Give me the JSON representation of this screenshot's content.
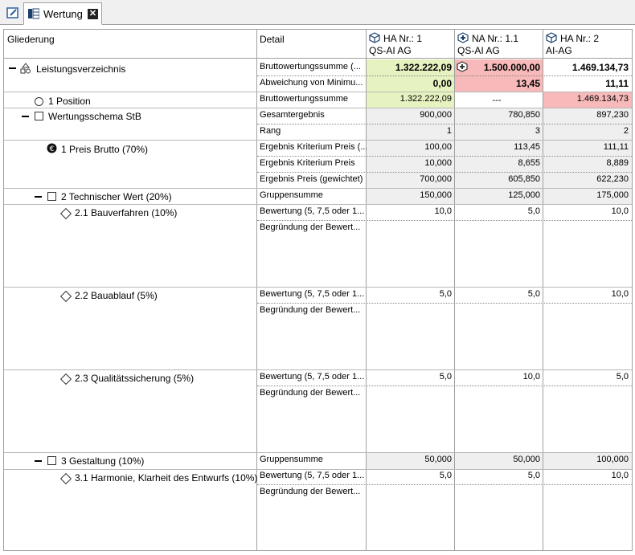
{
  "tab": {
    "label": "Wertung",
    "close": "✕"
  },
  "columns": {
    "gliederung": "Gliederung",
    "detail": "Detail",
    "bidders": [
      {
        "line1": "HA Nr.: 1",
        "line2": "QS-AI AG"
      },
      {
        "line1": "NA Nr.: 1.1",
        "line2": "QS-AI AG"
      },
      {
        "line1": "HA Nr.: 2",
        "line2": "AI-AG"
      }
    ]
  },
  "tree": {
    "lv": "Leistungsverzeichnis",
    "position": "1 Position",
    "schema": "Wertungsschema StB",
    "preis": "1 Preis Brutto (70%)",
    "techn": "2 Technischer Wert (20%)",
    "bauverf": "2.1 Bauverfahren (10%)",
    "bauabl": "2.2 Bauablauf (5%)",
    "quali": "2.3 Qualitätssicherung (5%)",
    "gestalt": "3 Gestaltung (10%)",
    "harmonie": "3.1 Harmonie, Klarheit des Entwurfs (10%)"
  },
  "details": {
    "bws_trunc": "Bruttowertungssumme (...",
    "abw": "Abweichung von Minimu...",
    "bws": "Bruttowertungssumme",
    "gesamt": "Gesamtergebnis",
    "rang": "Rang",
    "krit_trunc": "Ergebnis Kriterium Preis (...",
    "krit": "Ergebnis Kriterium Preis",
    "preis_gew": "Ergebnis Preis (gewichtet)",
    "gruppe": "Gruppensumme",
    "bewertung": "Bewertung (5, 7,5 oder 1...",
    "begr": "Begründung der Bewert..."
  },
  "values": {
    "lv_bws": [
      "1.322.222,09",
      "1.500.000,00",
      "1.469.134,73"
    ],
    "lv_abw": [
      "0,00",
      "13,45",
      "11,11"
    ],
    "pos_bws": [
      "1.322.222,09",
      "---",
      "1.469.134,73"
    ],
    "gesamt": [
      "900,000",
      "780,850",
      "897,230"
    ],
    "rang": [
      "1",
      "3",
      "2"
    ],
    "krit_pct": [
      "100,00",
      "113,45",
      "111,11"
    ],
    "krit": [
      "10,000",
      "8,655",
      "8,889"
    ],
    "preis_gew": [
      "700,000",
      "605,850",
      "622,230"
    ],
    "techn_gruppe": [
      "150,000",
      "125,000",
      "175,000"
    ],
    "bauverf": [
      "10,0",
      "5,0",
      "10,0"
    ],
    "bauabl": [
      "5,0",
      "5,0",
      "10,0"
    ],
    "quali": [
      "5,0",
      "10,0",
      "5,0"
    ],
    "gestalt_gruppe": [
      "50,000",
      "50,000",
      "100,000"
    ],
    "harmonie": [
      "5,0",
      "5,0",
      "10,0"
    ]
  },
  "colors": {
    "green": "#e6f2c0",
    "red": "#f7b9b9",
    "gray": "#efefef"
  }
}
